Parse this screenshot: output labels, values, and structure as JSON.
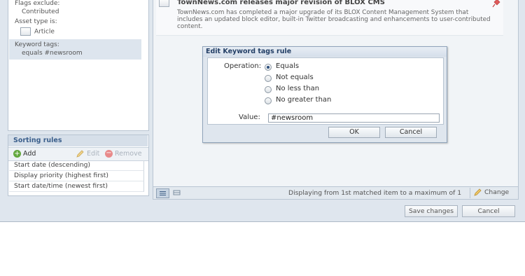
{
  "left_panel": {
    "rules": [
      {
        "label": "Flags exclude:",
        "value": "Contributed"
      },
      {
        "label": "Asset type is:",
        "value": "Article"
      },
      {
        "label": "Keyword tags:",
        "value": "equals #newsroom"
      }
    ]
  },
  "sorting": {
    "title": "Sorting rules",
    "add_label": "Add",
    "edit_label": "Edit",
    "remove_label": "Remove",
    "items": [
      "Start date (descending)",
      "Display priority (highest first)",
      "Start date/time (newest first)"
    ]
  },
  "article": {
    "title": "TownNews.com releases major revision of BLOX CMS",
    "body": "TownNews.com has completed a major upgrade of its BLOX Content Management System that includes an updated block editor, built-in Twitter broadcasting and enhancements to user-contributed content."
  },
  "statusbar": {
    "text": "Displaying from 1st matched item to a maximum of 1",
    "change_label": "Change"
  },
  "footer": {
    "save_label": "Save changes",
    "cancel_label": "Cancel"
  },
  "dialog": {
    "title": "Edit Keyword tags rule",
    "operation_label": "Operation:",
    "options": [
      "Equals",
      "Not equals",
      "No less than",
      "No greater than"
    ],
    "selected": "Equals",
    "value_label": "Value:",
    "value": "#newsroom",
    "ok_label": "OK",
    "cancel_label": "Cancel"
  },
  "colors": {
    "frame": "#dfe6ee",
    "title_blue": "#233f66",
    "accent_blue": "#3b5f8c",
    "add_green": "#63a83e",
    "remove_red": "#e88a8a"
  }
}
